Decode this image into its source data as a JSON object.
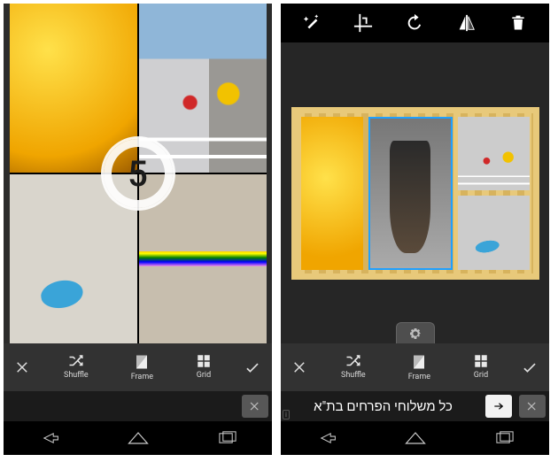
{
  "left": {
    "countdown_value": "5",
    "actions": {
      "cancel_icon": "close-icon",
      "shuffle_label": "Shuffle",
      "frame_label": "Frame",
      "grid_label": "Grid",
      "confirm_icon": "check-icon"
    },
    "collage_images": [
      "corn-macro",
      "street-taxi",
      "feet-sandals",
      "rainbow-floor"
    ],
    "ad": {
      "has_text": false
    }
  },
  "right": {
    "toolbar": {
      "magic": "magic-wand-icon",
      "crop": "crop-icon",
      "rotate": "rotate-icon",
      "flip": "flip-horizontal-icon",
      "delete": "trash-icon"
    },
    "board_images": [
      "corn-macro",
      "dog-window",
      "street-taxi",
      "feet-sandals"
    ],
    "selected_image_index": 1,
    "actions": {
      "cancel_icon": "close-icon",
      "shuffle_label": "Shuffle",
      "frame_label": "Frame",
      "grid_label": "Grid",
      "confirm_icon": "check-icon"
    },
    "ad": {
      "has_text": true,
      "text": "כל משלוחי הפרחים בת\"א",
      "marker": "i"
    }
  },
  "nav": {
    "back": "back",
    "home": "home",
    "recent": "recent"
  }
}
